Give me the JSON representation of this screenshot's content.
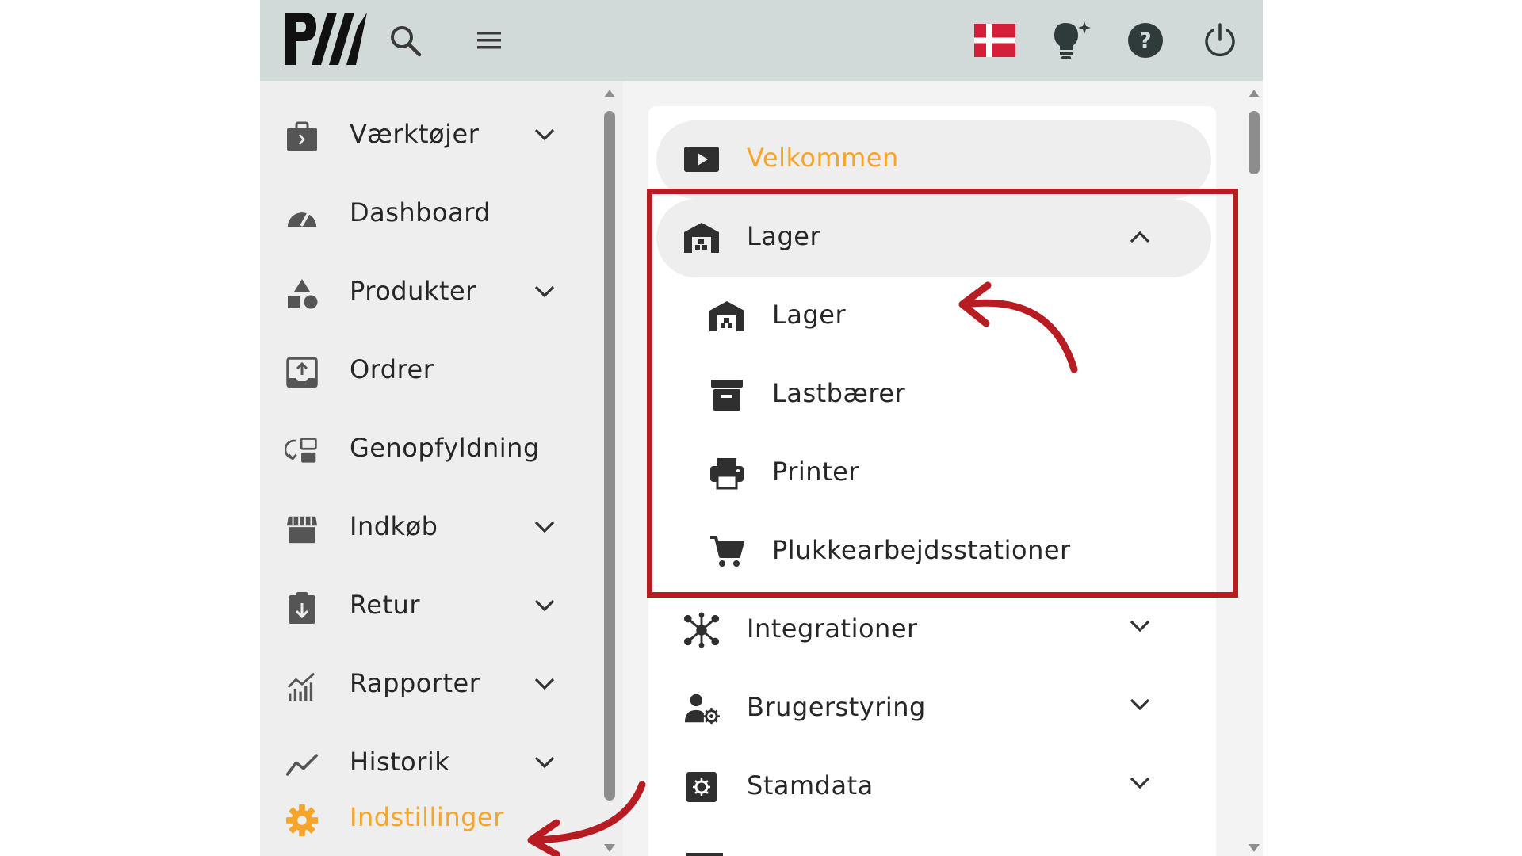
{
  "header": {
    "logo_text": "PW",
    "icons": [
      "search-icon",
      "menu-icon",
      "danish-flag-icon",
      "lightbulb-icon",
      "help-icon",
      "power-icon"
    ]
  },
  "sidebar": {
    "items": [
      {
        "label": "Værktøjer",
        "icon": "toolbox-icon",
        "expandable": true
      },
      {
        "label": "Dashboard",
        "icon": "speedometer-icon",
        "expandable": false
      },
      {
        "label": "Produkter",
        "icon": "shapes-icon",
        "expandable": true
      },
      {
        "label": "Ordrer",
        "icon": "upload-tray-icon",
        "expandable": false
      },
      {
        "label": "Genopfyldning",
        "icon": "replenish-icon",
        "expandable": false
      },
      {
        "label": "Indkøb",
        "icon": "storefront-icon",
        "expandable": true
      },
      {
        "label": "Retur",
        "icon": "return-clipboard-icon",
        "expandable": true
      },
      {
        "label": "Rapporter",
        "icon": "bar-chart-icon",
        "expandable": true
      },
      {
        "label": "Historik",
        "icon": "trend-line-icon",
        "expandable": true
      },
      {
        "label": "Indstillinger",
        "icon": "gear-icon",
        "expandable": false,
        "active": true
      }
    ]
  },
  "settings_menu": {
    "welcome": {
      "label": "Velkommen",
      "icon": "play-icon"
    },
    "lager_group": {
      "label": "Lager",
      "icon": "warehouse-icon",
      "expanded": true,
      "children": [
        {
          "label": "Lager",
          "icon": "warehouse-icon"
        },
        {
          "label": "Lastbærer",
          "icon": "archive-box-icon"
        },
        {
          "label": "Printer",
          "icon": "printer-icon"
        },
        {
          "label": "Plukkearbejdsstationer",
          "icon": "cart-icon"
        }
      ]
    },
    "items": [
      {
        "label": "Integrationer",
        "icon": "hub-icon"
      },
      {
        "label": "Brugerstyring",
        "icon": "user-gear-icon"
      },
      {
        "label": "Stamdata",
        "icon": "settings-box-icon"
      }
    ]
  },
  "colors": {
    "topbar": "#d2d9d9",
    "sidebar": "#eeeeee",
    "accent": "#f5a52a",
    "highlight": "#b71c22",
    "text": "#262626",
    "icon": "#555555"
  }
}
